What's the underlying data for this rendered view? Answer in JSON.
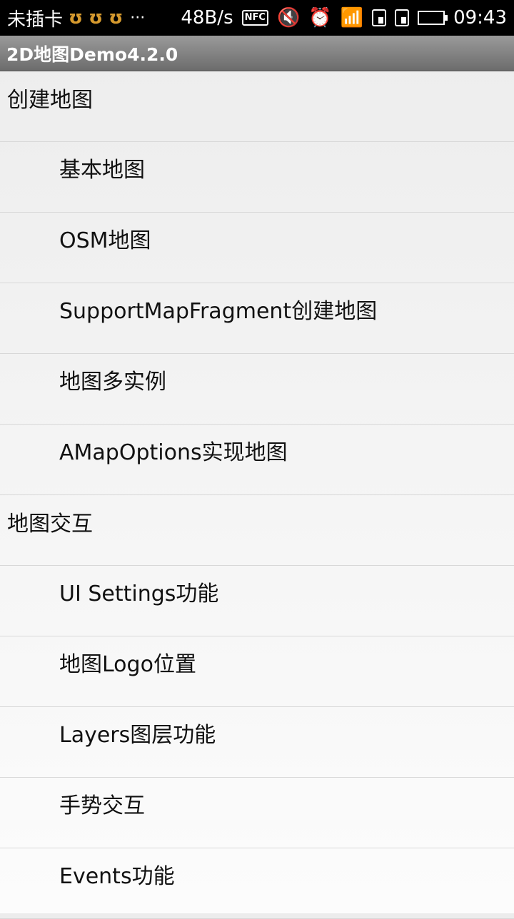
{
  "status_bar": {
    "carrier": "未插卡",
    "more": "···",
    "speed": "48B/s",
    "nfc": "NFC",
    "time": "09:43"
  },
  "action_bar": {
    "title": "2D地图Demo4.2.0"
  },
  "list": {
    "rows": [
      {
        "label": "创建地图",
        "kind": "group"
      },
      {
        "label": "基本地图",
        "kind": "child"
      },
      {
        "label": "OSM地图",
        "kind": "child"
      },
      {
        "label": "SupportMapFragment创建地图",
        "kind": "child"
      },
      {
        "label": "地图多实例",
        "kind": "child"
      },
      {
        "label": "AMapOptions实现地图",
        "kind": "child"
      },
      {
        "label": "地图交互",
        "kind": "group"
      },
      {
        "label": "UI Settings功能",
        "kind": "child"
      },
      {
        "label": "地图Logo位置",
        "kind": "child"
      },
      {
        "label": "Layers图层功能",
        "kind": "child"
      },
      {
        "label": "手势交互",
        "kind": "child"
      },
      {
        "label": "Events功能",
        "kind": "child"
      }
    ]
  }
}
